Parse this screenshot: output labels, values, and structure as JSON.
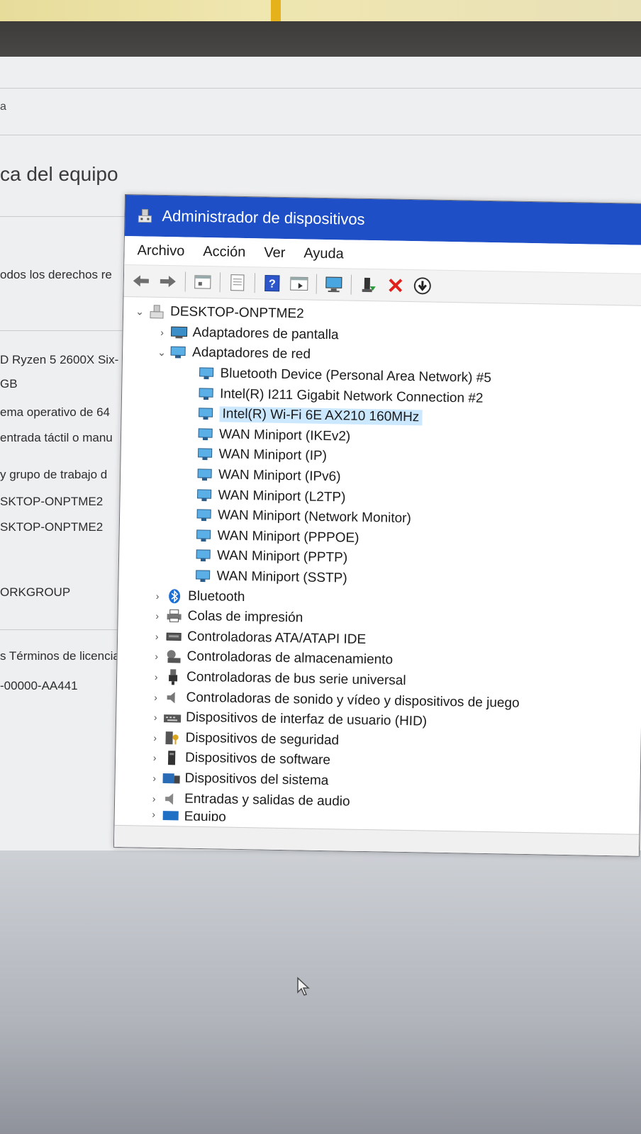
{
  "background_window": {
    "title": "ca del equipo",
    "top_letter": "a",
    "lines": [
      "odos los derechos re",
      "D Ryzen 5 2600X Six-",
      "GB",
      "ema operativo de 64",
      "entrada táctil o manu",
      "y grupo de trabajo d",
      "SKTOP-ONPTME2",
      "SKTOP-ONPTME2",
      "ORKGROUP",
      "s Términos de licencia",
      "-00000-AA441"
    ]
  },
  "window": {
    "title": "Administrador de dispositivos",
    "menu": [
      "Archivo",
      "Acción",
      "Ver",
      "Ayuda"
    ]
  },
  "tree": {
    "root": "DESKTOP-ONPTME2",
    "display_adapters": "Adaptadores de pantalla",
    "network_adapters": "Adaptadores de red",
    "network_children": [
      "Bluetooth Device (Personal Area Network) #5",
      "Intel(R) I211 Gigabit Network Connection #2",
      "Intel(R) Wi-Fi 6E AX210 160MHz",
      "WAN Miniport (IKEv2)",
      "WAN Miniport (IP)",
      "WAN Miniport (IPv6)",
      "WAN Miniport (L2TP)",
      "WAN Miniport (Network Monitor)",
      "WAN Miniport (PPPOE)",
      "WAN Miniport (PPTP)",
      "WAN Miniport (SSTP)"
    ],
    "categories": [
      "Bluetooth",
      "Colas de impresión",
      "Controladoras ATA/ATAPI IDE",
      "Controladoras de almacenamiento",
      "Controladoras de bus serie universal",
      "Controladoras de sonido y vídeo y dispositivos de juego",
      "Dispositivos de interfaz de usuario (HID)",
      "Dispositivos de seguridad",
      "Dispositivos de software",
      "Dispositivos del sistema",
      "Entradas y salidas de audio",
      "Equipo"
    ]
  },
  "colors": {
    "title_bar": "#1e4fc7",
    "selection": "#cce8ff",
    "remove_icon": "#e0201b"
  },
  "icons": {
    "toolbar": [
      "back-arrow-icon",
      "forward-arrow-icon",
      "properties-icon",
      "driver-icon",
      "help-icon",
      "view-icon",
      "monitor-scan-icon",
      "add-driver-icon",
      "uninstall-x-icon",
      "update-down-icon"
    ]
  }
}
